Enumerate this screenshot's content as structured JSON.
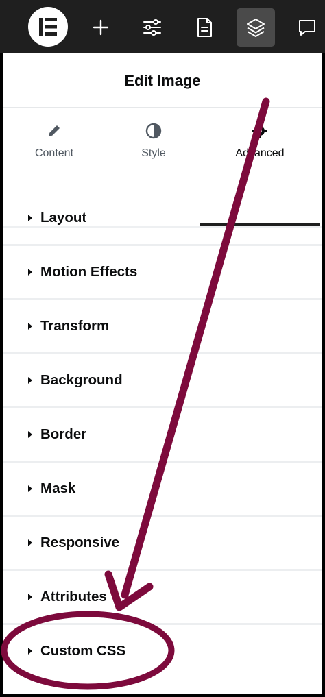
{
  "toolbar": {
    "logo": "elementor-logo",
    "buttons": [
      {
        "icon": "plus-icon"
      },
      {
        "icon": "sliders-icon"
      },
      {
        "icon": "page-icon"
      },
      {
        "icon": "layers-icon",
        "active": true
      },
      {
        "icon": "comment-icon"
      }
    ]
  },
  "panel": {
    "title": "Edit Image",
    "tabs": [
      {
        "label": "Content",
        "icon": "pencil-icon"
      },
      {
        "label": "Style",
        "icon": "half-circle-icon"
      },
      {
        "label": "Advanced",
        "icon": "gear-icon",
        "active": true
      }
    ],
    "sections": [
      {
        "label": "Layout"
      },
      {
        "label": "Motion Effects"
      },
      {
        "label": "Transform"
      },
      {
        "label": "Background"
      },
      {
        "label": "Border"
      },
      {
        "label": "Mask"
      },
      {
        "label": "Responsive"
      },
      {
        "label": "Attributes"
      },
      {
        "label": "Custom CSS"
      }
    ]
  },
  "annotation": {
    "color": "#7d0a3c",
    "shapes": [
      "arrow-pointing-to-custom-css",
      "ellipse-around-custom-css"
    ]
  }
}
